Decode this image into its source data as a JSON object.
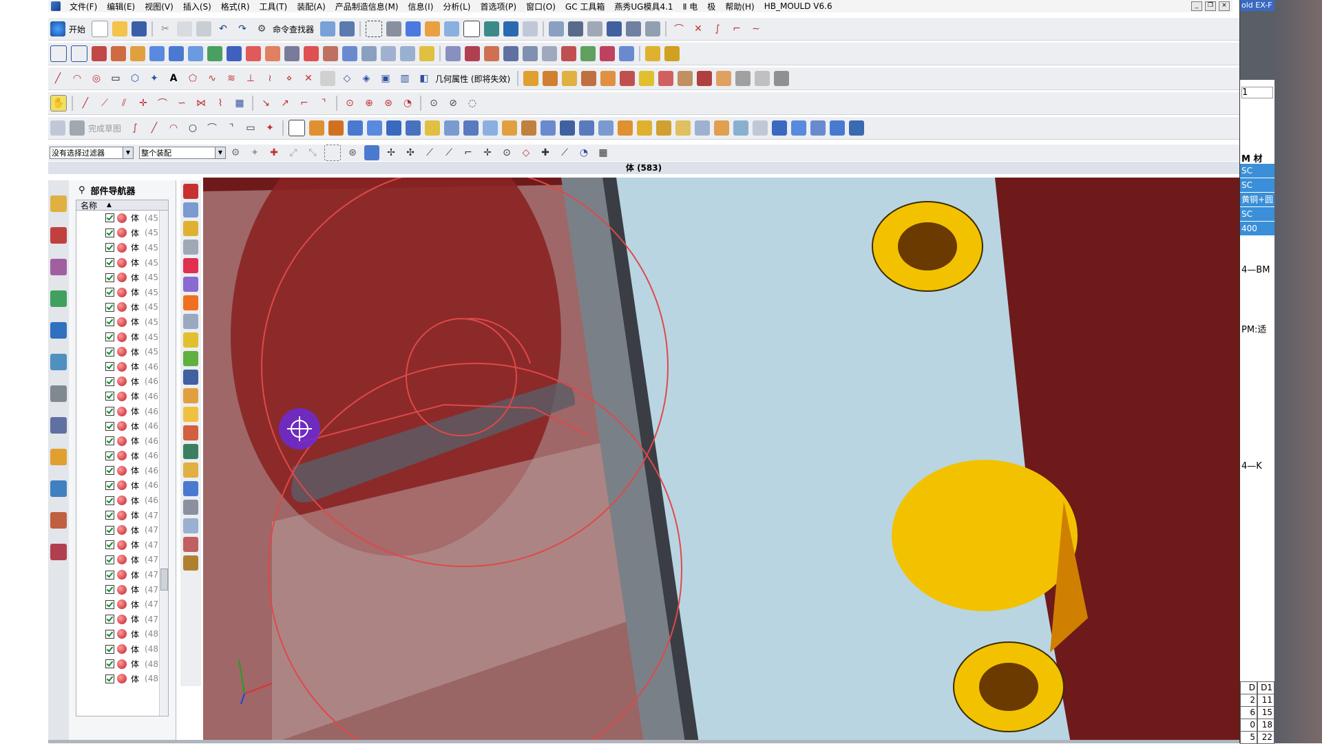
{
  "menubar": {
    "items": [
      "文件(F)",
      "编辑(E)",
      "视图(V)",
      "插入(S)",
      "格式(R)",
      "工具(T)",
      "装配(A)",
      "产品制造信息(M)",
      "信息(I)",
      "分析(L)",
      "首选项(P)",
      "窗口(O)",
      "GC 工具箱",
      "燕秀UG模具4.1",
      "Ⅱ 电",
      "极",
      "帮助(H)",
      "HB_MOULD V6.6"
    ]
  },
  "toolbar1": {
    "start_label": "开始",
    "cmd_finder_label": "命令查找器"
  },
  "toolbar3": {
    "geom_label": "几何属性 (即将失效)"
  },
  "toolbar5": {
    "sketch_label": "完成草图"
  },
  "selection_bar": {
    "filter_value": "没有选择过滤器",
    "scope_value": "整个装配"
  },
  "viewport": {
    "title": "体 (583)"
  },
  "navigator": {
    "title": "部件导航器",
    "column_name": "名称",
    "row_label": "体",
    "rows": [
      "(45",
      "(45",
      "(45",
      "(45",
      "(45",
      "(45",
      "(45",
      "(45",
      "(45",
      "(45",
      "(46",
      "(46",
      "(46",
      "(46",
      "(46",
      "(46",
      "(46",
      "(46",
      "(46",
      "(46",
      "(47",
      "(47",
      "(47",
      "(47",
      "(47",
      "(47",
      "(47",
      "(47",
      "(48",
      "(48",
      "(48",
      "(48"
    ]
  },
  "right_panel": {
    "top_text": "old EX-F",
    "page_value": "1",
    "material_header": "M 材",
    "blue_rows": [
      "SC",
      "SC",
      "黄铜+圆",
      "SC",
      "400"
    ],
    "text_bm": "4—BM",
    "text_pm": "PM:适",
    "text_k": "4—K",
    "table_header": [
      "D",
      "D1"
    ],
    "table_rows": [
      [
        "2",
        "11"
      ],
      [
        "6",
        "15"
      ],
      [
        "0",
        "18"
      ],
      [
        "5",
        "22"
      ]
    ]
  },
  "colors": {
    "mold_red": "#6e1a1a",
    "plate_blue": "#b9d5e2",
    "bushing_yellow": "#f2c200",
    "curve_red": "#e04848",
    "cursor_purple": "#6a2ad8"
  }
}
